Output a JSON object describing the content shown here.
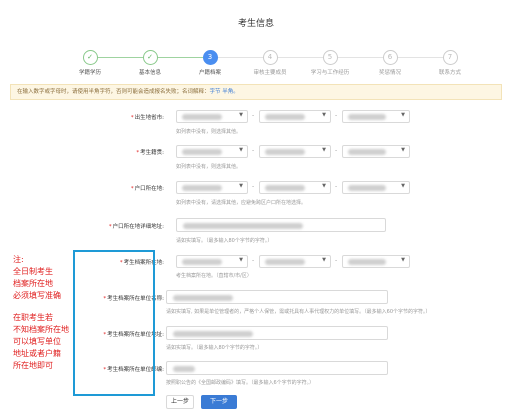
{
  "page": {
    "title": "考生信息"
  },
  "steps": [
    {
      "number": "✓",
      "label": "学籍学历",
      "state": "done"
    },
    {
      "number": "✓",
      "label": "基本信息",
      "state": "done"
    },
    {
      "number": "3",
      "label": "户籍档案",
      "state": "active"
    },
    {
      "number": "4",
      "label": "审核主要成员",
      "state": "todo"
    },
    {
      "number": "5",
      "label": "学习与工作经历",
      "state": "todo"
    },
    {
      "number": "6",
      "label": "奖惩情况",
      "state": "todo"
    },
    {
      "number": "7",
      "label": "联系方式",
      "state": "todo"
    }
  ],
  "notice": {
    "text": "在输入数字或字母时，请使用半角字符，否则可能会造成报名失败；名词解释：",
    "link": "字节 半角。"
  },
  "form": {
    "birthplace": {
      "label": "出生地省市:",
      "hint": "如列表中没有，则选择其他。"
    },
    "native_place": {
      "label": "考生籍贯:",
      "hint": "如列表中没有，则选择其他。"
    },
    "hukou": {
      "label": "户口所在地:",
      "hint": "如列表中没有，请选择其他，应避免跨区户口所在地选择。"
    },
    "hukou_address": {
      "label": "户口所在地详细地址:",
      "hint": "请如实填写。（最多输入80个字节的字符。）"
    },
    "archive_location": {
      "label": "考生档案所在地:",
      "hint": "考生档案所在地。（直辖市/市/区）"
    },
    "archive_unit": {
      "label": "考生档案所在单位名称:",
      "hint": "请如实填写, 如果是单位管理者的，严格个人保管，需或托具有人事代理权力的单位填写。（最多输入60个字节的字符。）"
    },
    "archive_address": {
      "label": "考生档案所在单位地址:",
      "hint": "请如实填写。（最多输入80个字节的字符。）"
    },
    "archive_postcode": {
      "label": "考生档案所在单位邮编:",
      "hint": "按照职公告的《全国邮政编码》填写。（最多输入6个字节的字符。）"
    }
  },
  "annotation": {
    "lines": [
      "注:",
      "全日制考生",
      "档案所在地",
      "必须填写准确",
      "",
      "在职考生若",
      "不知档案所在地",
      "可以填写单位",
      "地址或者户籍",
      "所在地即可"
    ]
  },
  "buttons": {
    "prev": "上一步",
    "next": "下一步"
  },
  "colors": {
    "primary": "#3a7bd5",
    "done": "#5db362",
    "annotation": "#e02020",
    "box": "#1e9ad6"
  }
}
